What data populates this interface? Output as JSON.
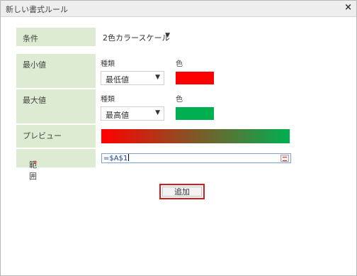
{
  "dialog": {
    "title": "新しい書式ルール",
    "close_glyph": "×"
  },
  "condition": {
    "label": "条件",
    "selected": "2色カラースケール"
  },
  "min": {
    "label": "最小値",
    "type_label": "種類",
    "color_label": "色",
    "type_selected": "最低値",
    "color": "#ff0000"
  },
  "max": {
    "label": "最大値",
    "type_label": "種類",
    "color_label": "色",
    "type_selected": "最高値",
    "color": "#00b050"
  },
  "preview": {
    "label": "プレビュー"
  },
  "range": {
    "label": "範囲",
    "required_mark": "*",
    "value": "=$A$1"
  },
  "actions": {
    "add_label": "追加"
  },
  "icons": {
    "close": "close-icon",
    "dropdown": "caret-down-icon",
    "range_picker": "range-select-icon"
  }
}
